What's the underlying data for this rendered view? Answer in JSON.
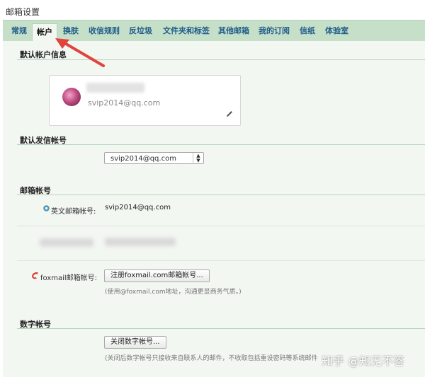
{
  "page": {
    "title": "邮箱设置"
  },
  "tabs": [
    {
      "label": "常规",
      "active": false
    },
    {
      "label": "帐户",
      "active": true
    },
    {
      "label": "换肤",
      "active": false
    },
    {
      "label": "收信规则",
      "active": false
    },
    {
      "label": "反垃圾",
      "active": false
    },
    {
      "label": "文件夹和标签",
      "active": false
    },
    {
      "label": "其他邮箱",
      "active": false
    },
    {
      "label": "我的订阅",
      "active": false
    },
    {
      "label": "信纸",
      "active": false
    },
    {
      "label": "体验室",
      "active": false
    }
  ],
  "default_account": {
    "title": "默认帐户信息",
    "email": "svip2014@qq.com"
  },
  "default_sender": {
    "title": "默认发信帐号",
    "selected": "svip2014@qq.com"
  },
  "mail_accounts": {
    "title": "邮箱帐号",
    "english_label": "英文邮箱帐号:",
    "english_value": "svip2014@qq.com",
    "foxmail_label": "foxmail邮箱帐号:",
    "foxmail_button": "注册foxmail.com邮箱帐号...",
    "foxmail_hint": "(使用@foxmail.com地址，沟通更显商务气质。)"
  },
  "digital_account": {
    "title": "数字帐号",
    "button": "关闭数字帐号...",
    "hint": "(关闭后数字帐号只接收来自联系人的邮件，不收取包括重设密码等系统邮件在内的其他邮件。)"
  },
  "watermark": "知乎 @知无不答",
  "colors": {
    "tabbar": "#c5dfc8",
    "content_bg": "#f3f7f2",
    "tab_text": "#1f5b8a",
    "arrow": "#e0443c"
  }
}
